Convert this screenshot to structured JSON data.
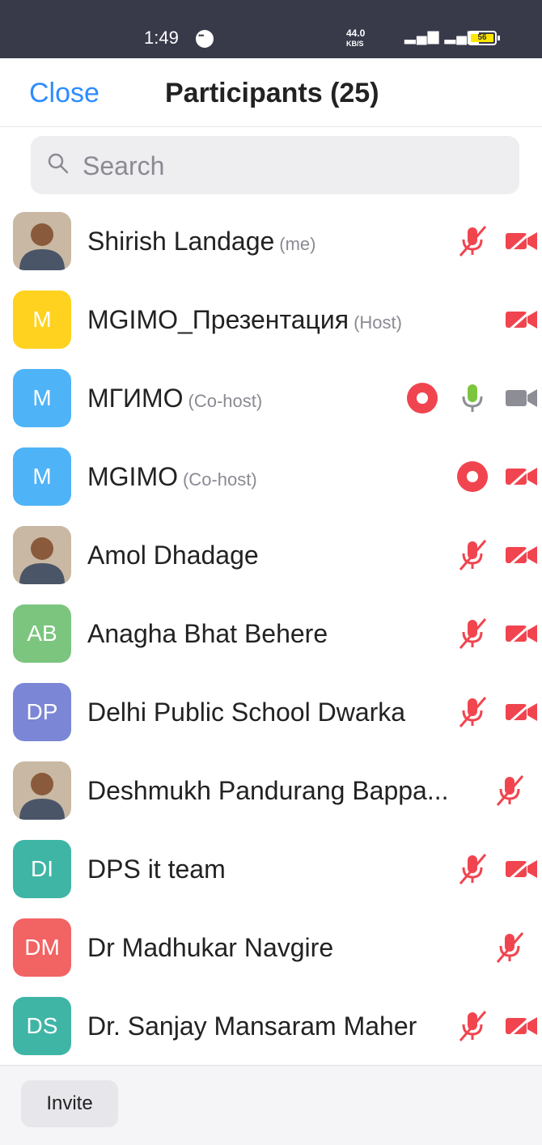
{
  "status_bar": {
    "time": "1:49",
    "network_speed": "44.0",
    "network_unit": "KB/S",
    "battery_level": "56"
  },
  "header": {
    "close_label": "Close",
    "title": "Participants (25)"
  },
  "search": {
    "placeholder": "Search"
  },
  "participants": [
    {
      "name": "Shirish Landage",
      "role": "(me)",
      "avatar_type": "photo",
      "mic": "muted",
      "video": "off"
    },
    {
      "name": "MGIMO_Презентация",
      "role": "(Host)",
      "avatar_type": "initials",
      "initials": "M",
      "avatar_color": "#ffd21f",
      "video": "off"
    },
    {
      "name": "МГИМО",
      "role": "(Co-host)",
      "avatar_type": "initials",
      "initials": "M",
      "avatar_color": "#4fb3f7",
      "recording": true,
      "mic": "on",
      "video": "on"
    },
    {
      "name": "MGIMO",
      "role": "(Co-host)",
      "avatar_type": "initials",
      "initials": "M",
      "avatar_color": "#4fb3f7",
      "recording": true,
      "video": "off"
    },
    {
      "name": "Amol Dhadage",
      "role": "",
      "avatar_type": "photo",
      "mic": "muted",
      "video": "off"
    },
    {
      "name": "Anagha Bhat Behere",
      "role": "",
      "avatar_type": "initials",
      "initials": "AB",
      "avatar_color": "#7cc57f",
      "mic": "muted",
      "video": "off"
    },
    {
      "name": "Delhi Public School Dwarka",
      "role": "",
      "avatar_type": "initials",
      "initials": "DP",
      "avatar_color": "#7b86d6",
      "mic": "muted",
      "video": "off"
    },
    {
      "name": "Deshmukh Pandurang Bappa...",
      "role": "",
      "avatar_type": "photo",
      "mic": "muted"
    },
    {
      "name": "DPS it team",
      "role": "",
      "avatar_type": "initials",
      "initials": "DI",
      "avatar_color": "#3fb5a6",
      "mic": "muted",
      "video": "off"
    },
    {
      "name": "Dr Madhukar Navgire",
      "role": "",
      "avatar_type": "initials",
      "initials": "DM",
      "avatar_color": "#f26363",
      "mic": "muted"
    },
    {
      "name": "Dr. Sanjay Mansaram Maher",
      "role": "",
      "avatar_type": "initials",
      "initials": "DS",
      "avatar_color": "#3fb5a6",
      "mic": "muted",
      "video": "off"
    }
  ],
  "footer": {
    "invite_label": "Invite"
  },
  "colors": {
    "accent": "#2d8cff",
    "muted_red": "#f0454f",
    "mic_on_green": "#7cc53f",
    "video_on_gray": "#8d8d95"
  }
}
